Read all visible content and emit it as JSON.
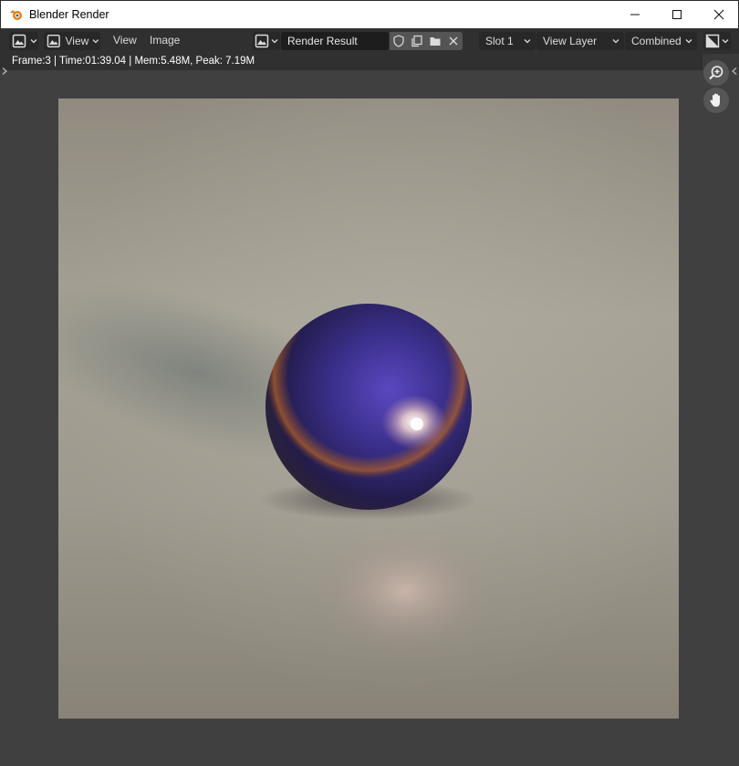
{
  "window": {
    "title": "Blender Render"
  },
  "header": {
    "view_menu_label": "View",
    "menu_items": [
      "View",
      "Image"
    ],
    "image_name": "Render Result",
    "slot": "Slot 1",
    "view_layer": "View Layer",
    "pass": "Combined"
  },
  "status": {
    "text": "Frame:3 | Time:01:39.04 | Mem:5.48M, Peak: 7.19M"
  },
  "icons": {
    "app": "blender-logo-icon",
    "editor_type": "image-editor-icon",
    "zoom": "zoom-in-icon",
    "pan": "hand-icon"
  },
  "colors": {
    "background": "#404040",
    "header": "#303030",
    "sphere": "#3a2f8a"
  }
}
